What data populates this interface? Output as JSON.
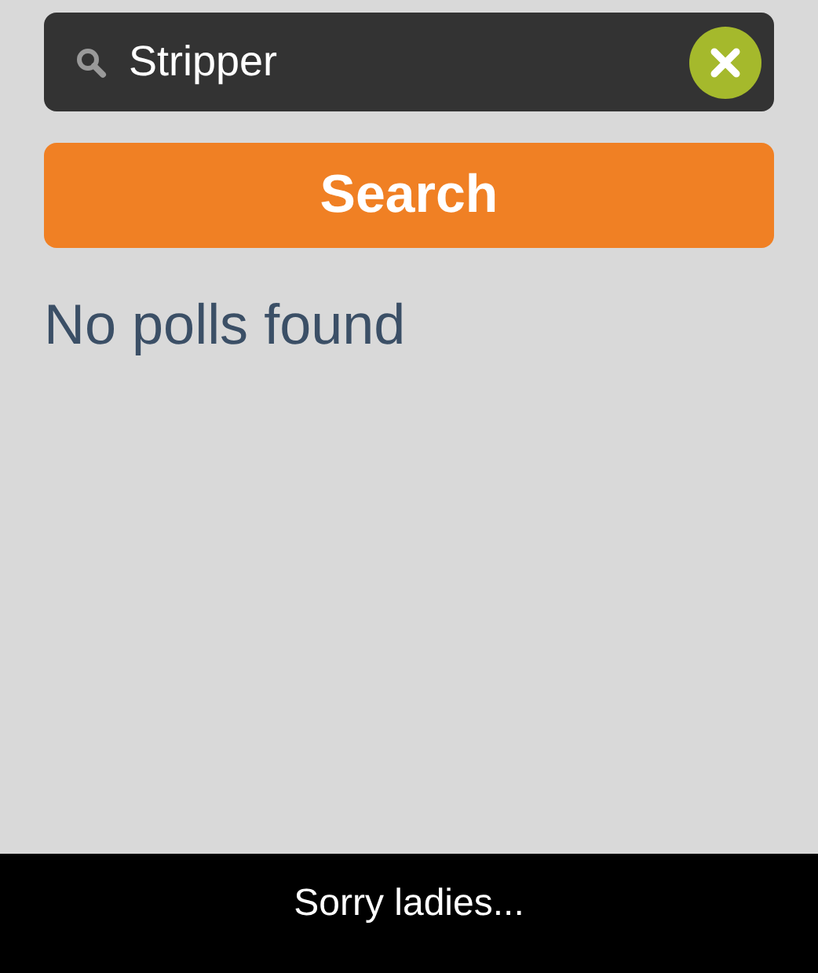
{
  "search_field": {
    "value": "Stripper"
  },
  "search_button": {
    "label": "Search"
  },
  "result_message": "No polls found",
  "caption": "Sorry ladies..."
}
